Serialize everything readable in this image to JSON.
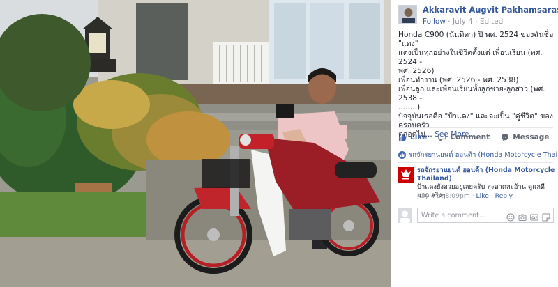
{
  "post": {
    "author": "Akkaravit Augvit Pakhamsarasri",
    "follow_label": "Follow",
    "separator": " · ",
    "date": "July 4",
    "edited": "Edited",
    "text_lines": [
      "Honda C900 (นันทิดา) ปี พศ. 2524 ของฉันชื่อ \"แดง\"",
      "แดงเป็นทุกอย่างในชีวิตตั้งแต่ เพื่อนเรียน (พศ. 2524 -",
      "พศ. 2526)",
      "เพื่อนทำงาน (พศ. 2526 - พศ. 2538)",
      "เพื่อนลูก และเพื่อนเรียนทั้งลูกชาย-ลูกสาว (พศ. 2538 -",
      "........)",
      "ปัจจุบันเธอคือ \"ป้าแดง\" และจะเป็น \"คู่ชีวิต\" ของครอบครัว",
      "ตลอดไป..."
    ],
    "see_more": "See More"
  },
  "actions": {
    "like": "Like",
    "comment": "Comment",
    "message": "Message"
  },
  "reaction": {
    "who": "รถจักรยานยนต์ ฮอนด้า (Honda Motorcycle Thailand)"
  },
  "comment": {
    "author": "รถจักรยานยนต์ ฮอนด้า (Honda Motorcycle Thailand)",
    "text": "ป้าแดงยังสวยอยู่เลยครับ สะอาดสะอ้าน ดูแลดีมาก จริงๆ",
    "time": "July 4 at 8:09pm",
    "like": "Like",
    "reply": "Reply",
    "dot": " · "
  },
  "composer": {
    "placeholder": "Write a comment...",
    "icons": [
      "emoji-icon",
      "camera-icon",
      "gif-icon",
      "sticker-icon"
    ]
  },
  "colors": {
    "link": "#365899",
    "meta": "#90949c",
    "like_blue": "#4267b2",
    "brand_red": "#cc0000"
  }
}
